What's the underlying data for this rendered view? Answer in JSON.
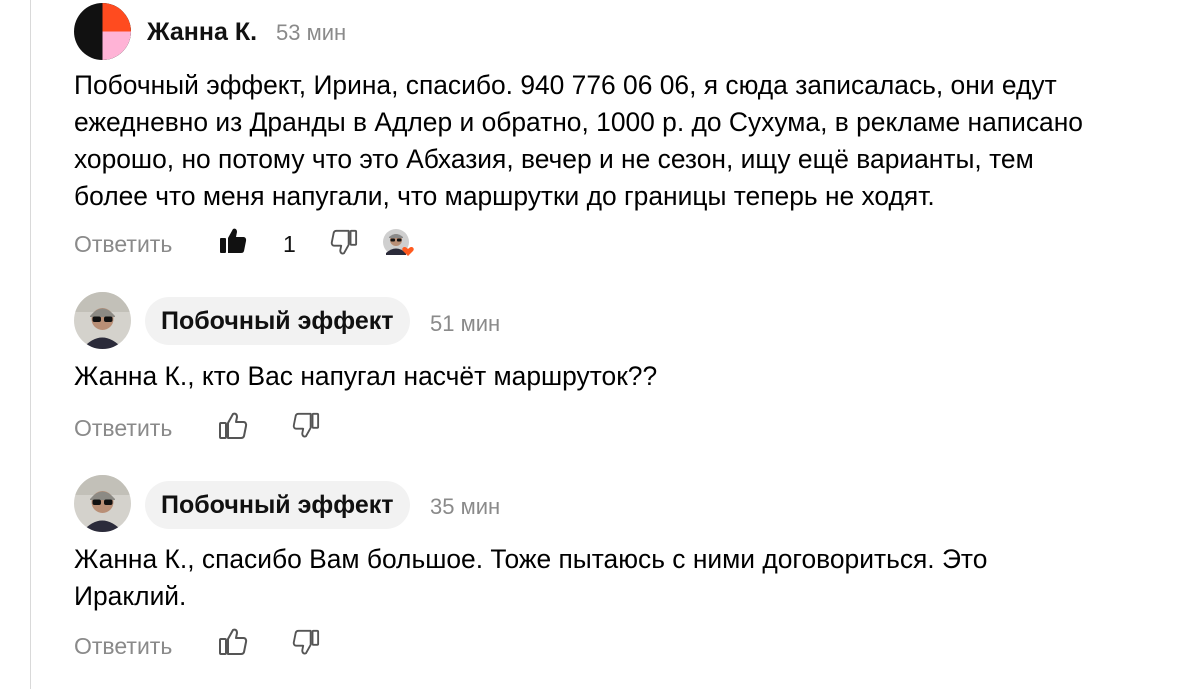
{
  "colors": {
    "meta_text": "#8a8a8a",
    "chip_background": "#f2f2f2",
    "heart": "#ff5a1f",
    "avatar_orange": "#ff4b1f",
    "avatar_pink": "#ffb3d6"
  },
  "comments": [
    {
      "author": "Жанна К.",
      "time": "53 мин",
      "text": "Побочный эффект, Ирина, спасибо. 940 776 06 06, я сюда записалась, они едут\nежедневно из Дранды в Адлер и обратно, 1000 р. до Сухума, в рекламе написано\nхорошо, но потому что это Абхазия, вечер и не сезон, ищу ещё варианты, тем\nболее что меня напугали, что маршрутки до границы теперь не ходят.",
      "reply_label": "Ответить",
      "likes": "1",
      "liked": true,
      "liked_by_author": true
    },
    {
      "author": "Побочный эффект",
      "time": "51 мин",
      "text": "Жанна К., кто Вас напугал насчёт маршруток??",
      "reply_label": "Ответить"
    },
    {
      "author": "Побочный эффект",
      "time": "35 мин",
      "text": "Жанна К., спасибо Вам большое. Тоже пытаюсь с ними договориться. Это\nИраклий.",
      "reply_label": "Ответить"
    }
  ]
}
